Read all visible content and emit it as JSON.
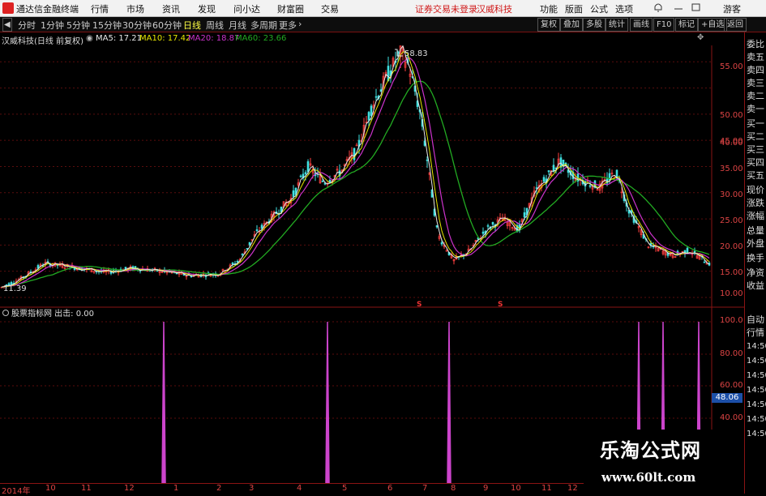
{
  "menubar": {
    "app_name": "通达信金融终端",
    "items": [
      "行情",
      "市场",
      "资讯",
      "发现",
      "问小达",
      "财富圈",
      "交易"
    ],
    "warning": "证券交易未登录",
    "stock_name": "汉威科技",
    "right_items": [
      "功能",
      "版面",
      "公式",
      "选项"
    ],
    "guest": "游客"
  },
  "toolbar": {
    "periods": [
      "分时",
      "1分钟",
      "5分钟",
      "15分钟",
      "30分钟",
      "60分钟",
      "日线",
      "周线",
      "月线",
      "多周期",
      "更多"
    ],
    "active_period": "日线",
    "buttons": [
      "复权",
      "叠加",
      "多股",
      "统计",
      "画线",
      "F10",
      "标记",
      "+自选",
      "返回"
    ]
  },
  "price_pane": {
    "title": "汉威科技(日线 前复权)",
    "ma5_label": "MA5: 17.21",
    "ma10_label": "MA10: 17.42",
    "ma20_label": "MA20: 18.87",
    "ma60_label": "MA60: 23.66",
    "ma_colors": {
      "ma5": "#e8e8e8",
      "ma10": "#e6e600",
      "ma20": "#cc33cc",
      "ma60": "#22aa22"
    },
    "high_label": "58.83",
    "low_label": "11.39",
    "price_axis": [
      "55.00",
      "50.00",
      "45.00",
      "40.00",
      "35.00",
      "30.00",
      "25.00",
      "20.00",
      "15.00",
      "10.00"
    ],
    "signal_marks": [
      "S",
      "S"
    ]
  },
  "indicator_pane": {
    "title": "股票指标网 出击: 0.00",
    "axis": [
      "100.0",
      "80.00",
      "60.00",
      "40.00"
    ],
    "current_value": "48.06",
    "spike_color": "#cc44cc"
  },
  "right_panel": {
    "items": [
      "委比",
      "卖五",
      "卖四",
      "卖三",
      "卖二",
      "卖一",
      "买一",
      "买二",
      "买三",
      "买四",
      "买五",
      "现价",
      "涨跌",
      "涨幅",
      "总量",
      "外盘",
      "换手",
      "净资",
      "收益",
      "自动",
      "行情",
      "14:50",
      "14:50",
      "14:50",
      "14:50",
      "14:50",
      "14:50",
      "14:50"
    ]
  },
  "bottom_axis": {
    "labels": [
      "2014年",
      "10",
      "11",
      "12",
      "1",
      "2",
      "3",
      "4",
      "5",
      "6",
      "7",
      "8",
      "9",
      "10",
      "11",
      "12"
    ]
  },
  "watermark": {
    "line1": "乐淘公式网",
    "line2": "www.60lt.com"
  }
}
